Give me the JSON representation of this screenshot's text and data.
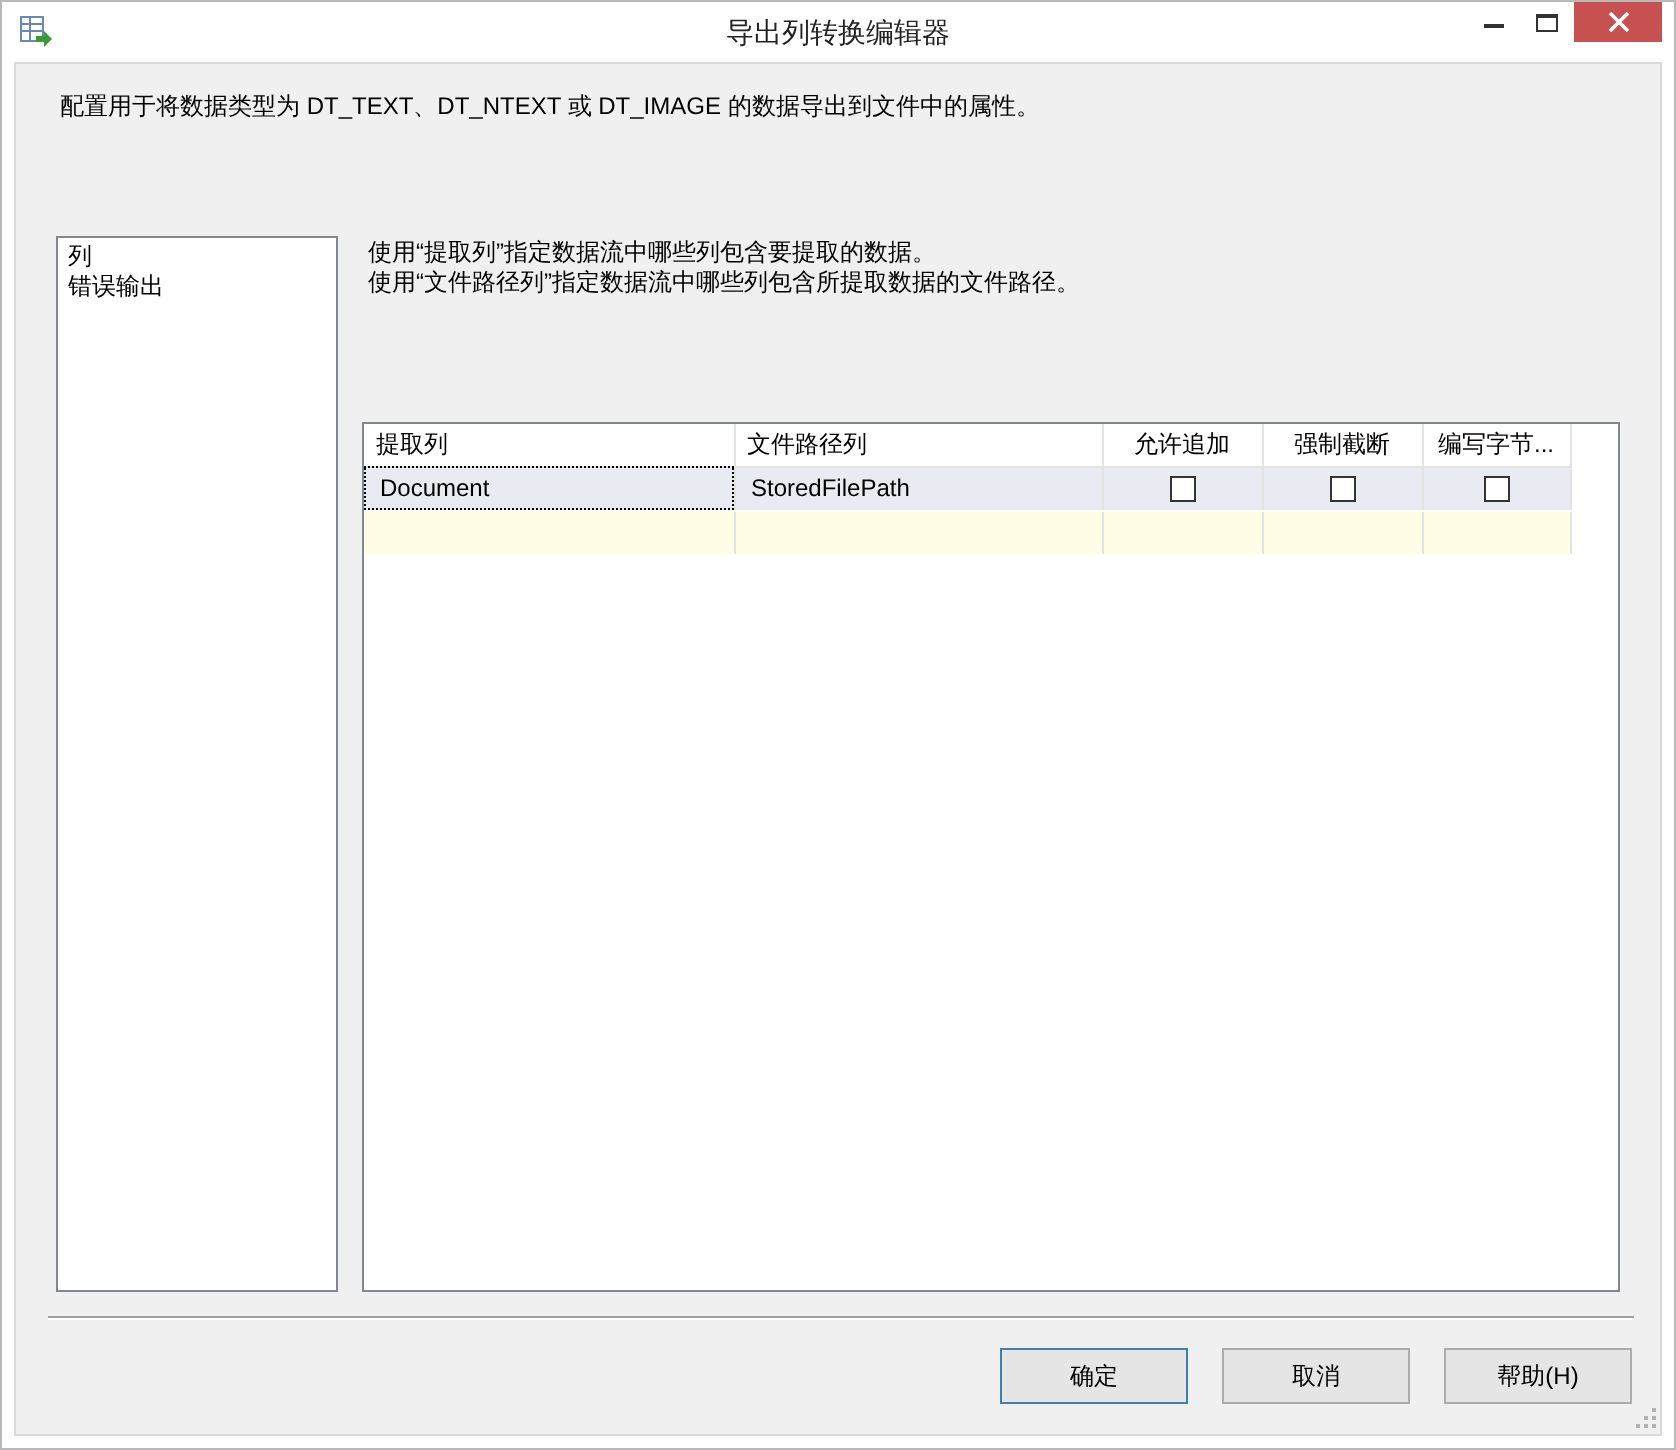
{
  "window": {
    "title": "导出列转换编辑器"
  },
  "description": "配置用于将数据类型为 DT_TEXT、DT_NTEXT 或 DT_IMAGE 的数据导出到文件中的属性。",
  "sidebar": {
    "items": [
      {
        "label": "列"
      },
      {
        "label": "错误输出"
      }
    ]
  },
  "instructions": [
    "使用“提取列”指定数据流中哪些列包含要提取的数据。",
    "使用“文件路径列”指定数据流中哪些列包含所提取数据的文件路径。"
  ],
  "grid": {
    "columns": [
      {
        "label": "提取列",
        "kind": "text"
      },
      {
        "label": "文件路径列",
        "kind": "text"
      },
      {
        "label": "允许追加",
        "kind": "checkbox"
      },
      {
        "label": "强制截断",
        "kind": "checkbox"
      },
      {
        "label": "编写字节...",
        "kind": "checkbox"
      }
    ],
    "rows": [
      {
        "kind": "data",
        "selected": true,
        "cells": [
          {
            "text": "Document",
            "focused": true
          },
          {
            "text": "StoredFilePath",
            "focused": false
          },
          {
            "checked": false,
            "focused": false
          },
          {
            "checked": false,
            "focused": false
          },
          {
            "checked": false,
            "focused": false
          }
        ]
      },
      {
        "kind": "new",
        "selected": false
      }
    ]
  },
  "buttons": [
    {
      "label": "确定",
      "default": true
    },
    {
      "label": "取消",
      "default": false
    },
    {
      "label": "帮助(H)",
      "default": false
    }
  ]
}
